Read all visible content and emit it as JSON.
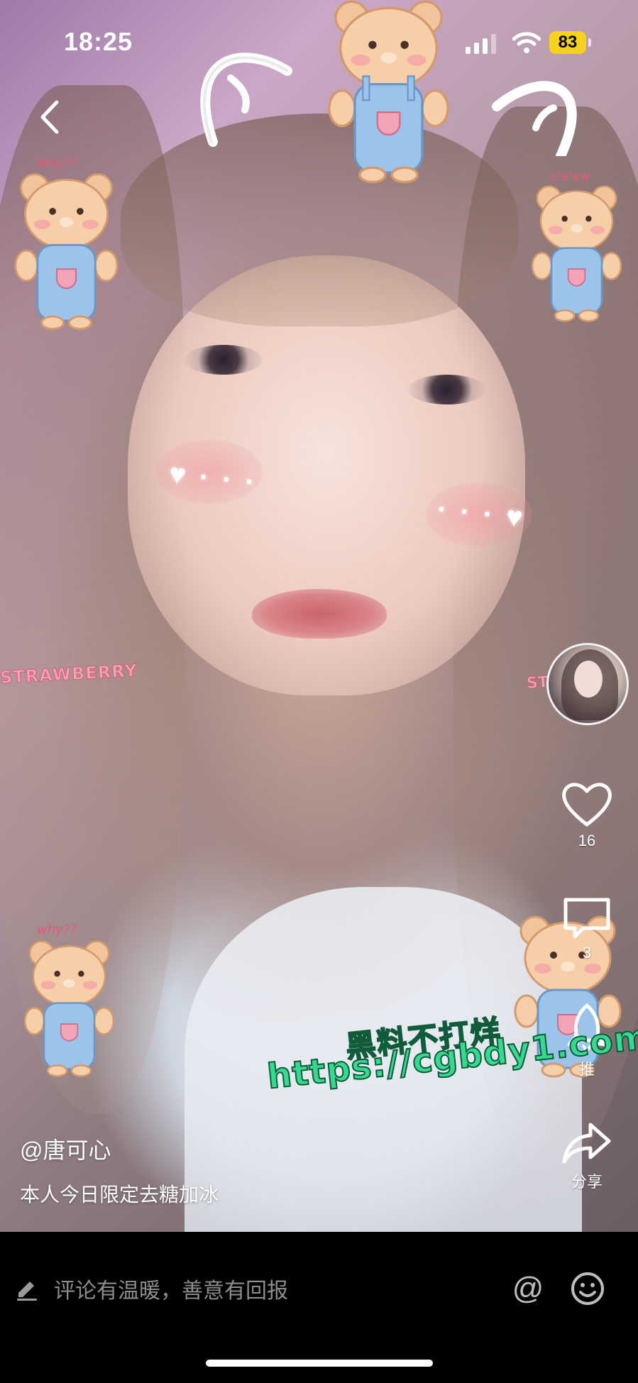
{
  "status_bar": {
    "time": "18:25",
    "battery": "83"
  },
  "video": {
    "stickers": {
      "bear_label_left": "why??",
      "bear_label_right": "s'e'aw",
      "bear_label_bottom": "why??",
      "strawberry": "STRAWBERRY",
      "strawberry_partial": "ST"
    },
    "sparkles": {
      "left": "♥ · · ·",
      "right": "· · · ♥"
    }
  },
  "actions": {
    "like_count": "16",
    "comment_count": "3",
    "push_label": "推",
    "share_label": "分享"
  },
  "watermark": {
    "title": "黑料不打烊",
    "url": "https://cgbdy1.com"
  },
  "post": {
    "author": "@唐可心",
    "caption": "本人今日限定去糖加冰"
  },
  "comment_bar": {
    "placeholder": "评论有温暖，善意有回报",
    "at_symbol": "@"
  },
  "icons": {
    "back": "chevron-left-icon",
    "like": "heart-icon",
    "comment": "comment-bubble-icon",
    "push": "rocket-icon",
    "share": "share-arrow-icon",
    "edit": "pencil-icon",
    "emoji": "smiley-icon"
  },
  "colors": {
    "watermark_green": "#35d98f",
    "battery_yellow": "#f7d21b",
    "comment_bar_bg": "#000000",
    "placeholder_gray": "#8d8d8d"
  }
}
